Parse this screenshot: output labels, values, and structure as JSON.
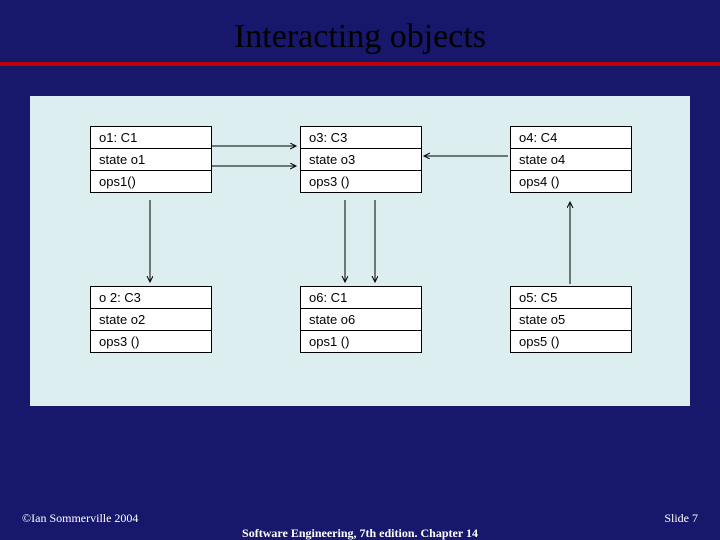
{
  "title": "Interacting objects",
  "objects": {
    "o1": {
      "header": "o1: C1",
      "state": "state o1",
      "ops": "ops1()"
    },
    "o3": {
      "header": "o3: C3",
      "state": "state o3",
      "ops": "ops3 ()"
    },
    "o4": {
      "header": "o4: C4",
      "state": "state o4",
      "ops": "ops4 ()"
    },
    "o2": {
      "header": "o 2: C3",
      "state": "state o2",
      "ops": "ops3 ()"
    },
    "o6": {
      "header": "o6: C1",
      "state": "state o6",
      "ops": "ops1 ()"
    },
    "o5": {
      "header": "o5: C5",
      "state": "state o5",
      "ops": "ops5 ()"
    }
  },
  "footer": {
    "copyright": "©Ian Sommerville 2004",
    "book": "Software Engineering, 7th edition. Chapter 14",
    "slide": "Slide  7"
  }
}
